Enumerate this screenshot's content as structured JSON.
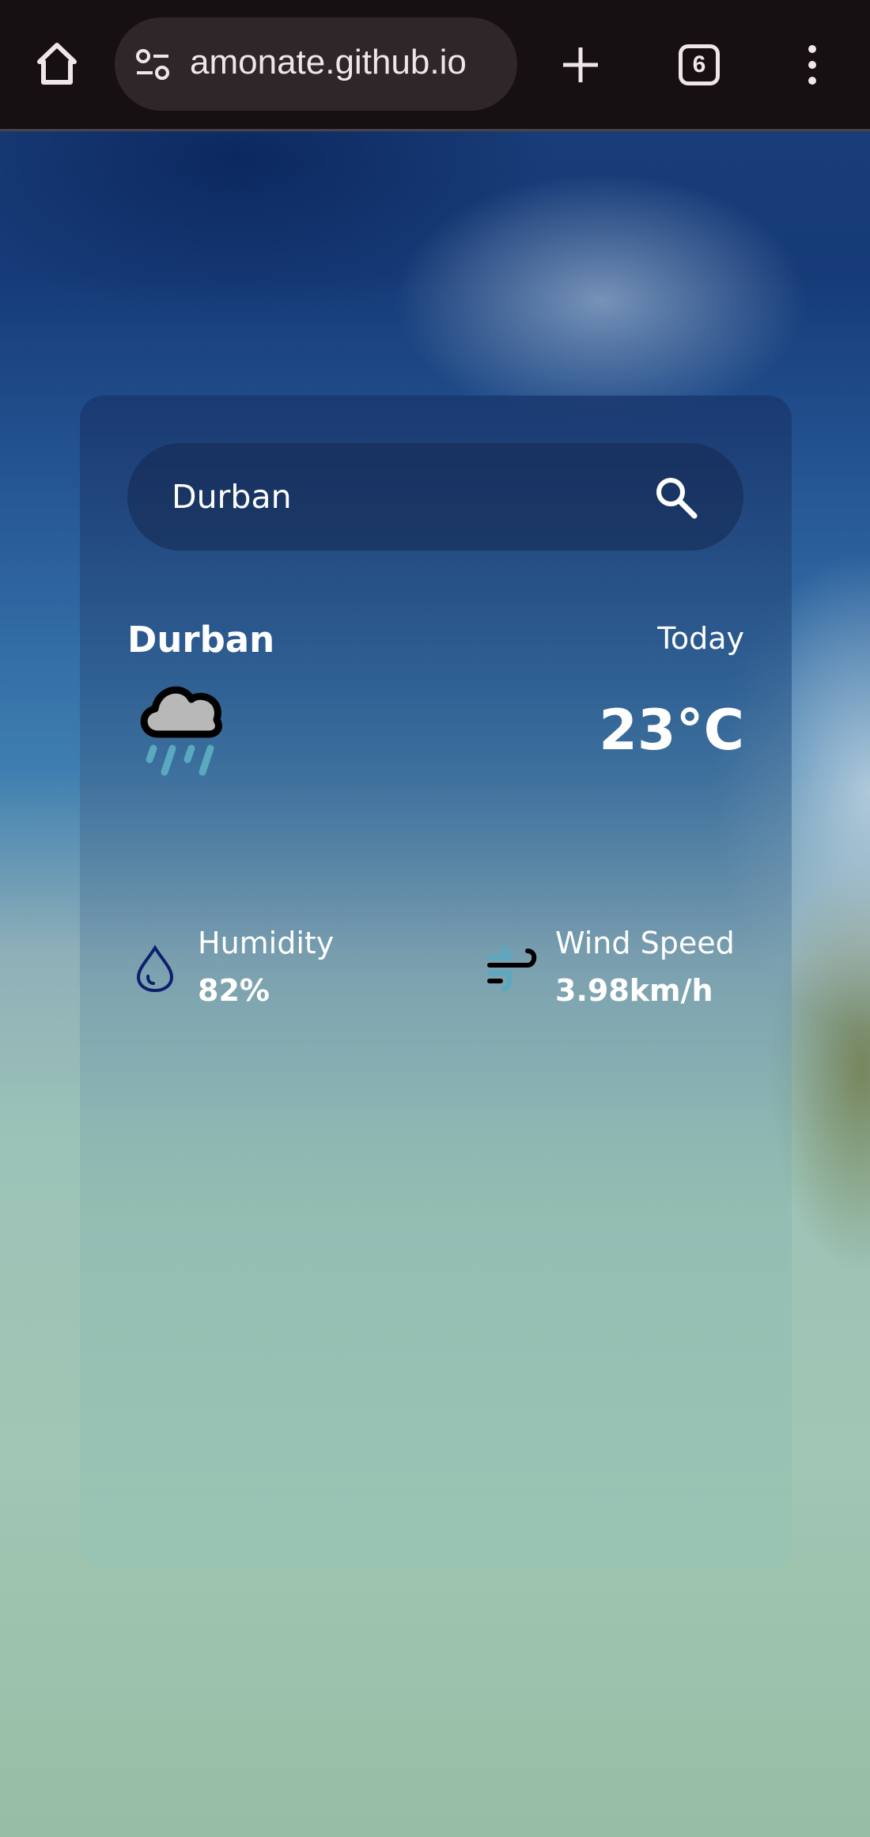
{
  "browser": {
    "url": "amonate.github.io",
    "tab_count": "6"
  },
  "search": {
    "value": "Durban"
  },
  "weather": {
    "city": "Durban",
    "day": "Today",
    "temperature": "23°C",
    "condition_icon": "rain-cloud-icon"
  },
  "details": {
    "humidity_label": "Humidity",
    "humidity_value": "82%",
    "wind_label": "Wind Speed",
    "wind_value": "3.98km/h"
  },
  "colors": {
    "rain": "#5aa9c0",
    "drop": "#0e1f6e"
  }
}
